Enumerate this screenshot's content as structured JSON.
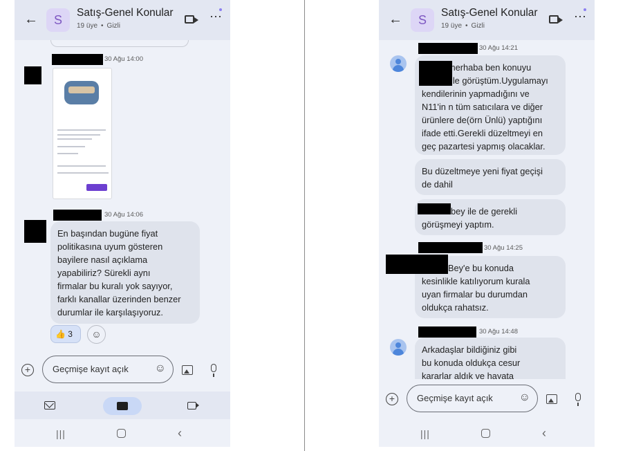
{
  "group": {
    "title": "Satış-Genel Konular",
    "avatar_letter": "S",
    "members": "19 üye",
    "privacy": "Gizli",
    "accent_color": "#7e57c2"
  },
  "left": {
    "messages": [
      {
        "time": "30 Ağu 14:00",
        "type": "image"
      },
      {
        "time": "30 Ağu 14:06",
        "lines": [
          "En başından bugüne fiyat",
          "politikasına uyum gösteren",
          "bayilere nasıl açıklama",
          "yapabiliriz? Sürekli aynı",
          "firmalar bu kuralı yok sayıyor,",
          "farklı kanallar üzerinden benzer",
          "durumlar ile karşılaşıyoruz."
        ]
      }
    ],
    "reaction": {
      "emoji": "👍",
      "count": "3"
    }
  },
  "right": {
    "messages": [
      {
        "time": "30 Ağu 14:21",
        "lines": [
          "merhaba ben konuyu",
          "ile görüştüm.Uygulamayı",
          "kendilerinin yapmadığını ve",
          "N11'in n tüm satıcılara ve diğer",
          "ürünlere de(örn Ünlü) yaptığını",
          "ifade etti.Gerekli düzeltmeyi en",
          "geç pazartesi yapmış olacaklar."
        ]
      },
      {
        "lines": [
          "Bu düzeltmeye yeni fiyat geçişi",
          "de dahil"
        ]
      },
      {
        "lines": [
          "bey ile de gerekli",
          "görüşmeyi yaptım."
        ]
      },
      {
        "time": "30 Ağu 14:25",
        "lines": [
          "Bey'e bu konuda",
          "kesinlikle katılıyorum kurala",
          "uyan firmalar bu durumdan",
          "oldukça rahatsız."
        ]
      },
      {
        "time": "30 Ağu 14:48",
        "lines": [
          "Arkadaşlar bildiğiniz gibi",
          "bu konuda oldukça cesur",
          "kararlar aldık ve hayata"
        ]
      }
    ]
  },
  "composer": {
    "placeholder": "Geçmişe kayıt açık"
  },
  "icons": [
    "back-arrow-icon",
    "video-call-icon",
    "more-options-icon",
    "add-icon",
    "emoji-icon",
    "image-icon",
    "mic-icon",
    "mail-icon",
    "chat-icon",
    "meet-icon",
    "recent-apps-icon",
    "home-icon",
    "system-back-icon"
  ]
}
